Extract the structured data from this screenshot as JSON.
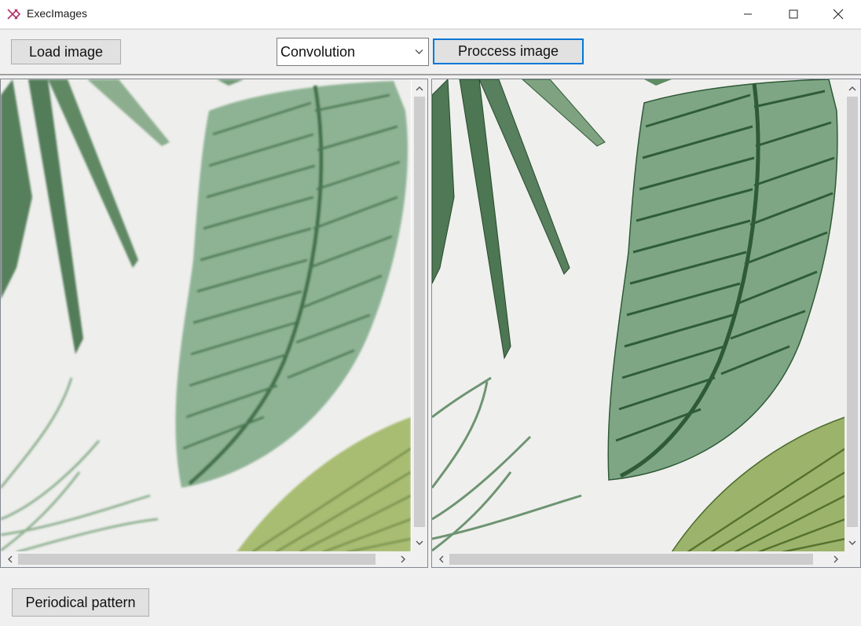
{
  "window": {
    "title": "ExecImages",
    "controls": [
      "minimize",
      "maximize",
      "close"
    ]
  },
  "toolbar": {
    "load_label": "Load image",
    "filter_selected": "Convolution",
    "process_label": "Proccess image"
  },
  "panels": {
    "original": {
      "name": "original-image",
      "scroll": [
        "up",
        "down",
        "left",
        "right"
      ]
    },
    "processed": {
      "name": "processed-image",
      "scroll": [
        "up",
        "down",
        "left",
        "right"
      ]
    }
  },
  "footer": {
    "pattern_label": "Periodical pattern"
  },
  "colors": {
    "accent": "#0078d7",
    "leaf_dark": "#3f6b45",
    "leaf_mid": "#7fa583",
    "leaf_light": "#a9c3a8",
    "leaf_yellow": "#9bb36a",
    "background": "#eeeeec"
  }
}
